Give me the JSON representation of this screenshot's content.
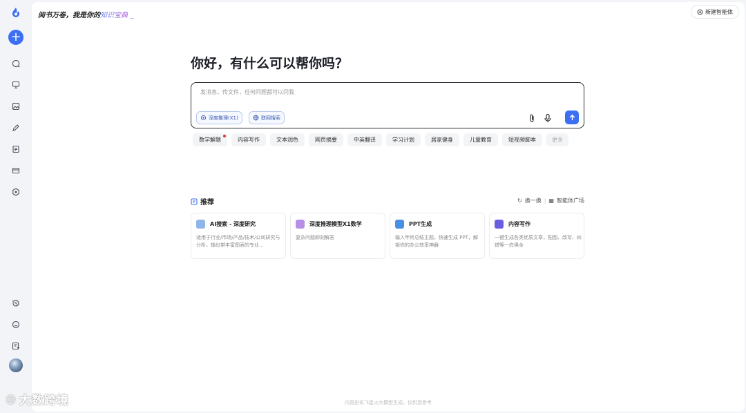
{
  "sidebar": {
    "new_label": "+",
    "icons": [
      "chat-bubble-icon",
      "presentation-icon",
      "image-icon",
      "pen-icon",
      "document-icon",
      "wallet-icon",
      "hexagon-icon"
    ],
    "bottom_icons": [
      "history-icon",
      "smile-icon",
      "notes-icon"
    ]
  },
  "header": {
    "slogan_prefix": "阅书万卷，我是你的",
    "slogan_accent": "知识宝典",
    "slogan_cursor": "_",
    "new_agent_label": "新建智能体"
  },
  "main": {
    "greeting": "你好，有什么可以帮你吗？",
    "input_placeholder": "发消息，传文件，任何问题都可以问我",
    "input_value": "",
    "toggles": [
      {
        "label": "深度推理(X1)",
        "icon": "brain-icon"
      },
      {
        "label": "联网搜索",
        "icon": "globe-icon"
      }
    ]
  },
  "chips": [
    {
      "label": "数学解题",
      "badge": true
    },
    {
      "label": "内容写作"
    },
    {
      "label": "文本润色"
    },
    {
      "label": "网页摘要"
    },
    {
      "label": "中英翻译"
    },
    {
      "label": "学习计划"
    },
    {
      "label": "居家健身"
    },
    {
      "label": "儿童教育"
    },
    {
      "label": "短视频脚本"
    },
    {
      "label": "更多"
    }
  ],
  "recommend": {
    "title": "推荐",
    "refresh_label": "换一换",
    "plaza_label": "智能体广场",
    "cards": [
      {
        "title": "AI搜索 - 深度研究",
        "desc": "适用于行业/市场/产品/技术/公司研究与分析，输出带丰富图表的专业...",
        "icon_color": "#8fb5e8"
      },
      {
        "title": "深度推理模型X1数学",
        "desc": "复杂问题即刻解答",
        "icon_color": "#b790e6"
      },
      {
        "title": "PPT生成",
        "desc": "输入年终总结主题，快速生成 PPT，解锁你的办公效率神器",
        "icon_color": "#4a90e2"
      },
      {
        "title": "内容写作",
        "desc": "一键生成各类优质文章，配图、改写、纠错等一应俱全",
        "icon_color": "#6b5de0"
      }
    ]
  },
  "footer_note": "内容由讯飞星火大模型生成，仅供您参考",
  "watermark": "大数跨境"
}
